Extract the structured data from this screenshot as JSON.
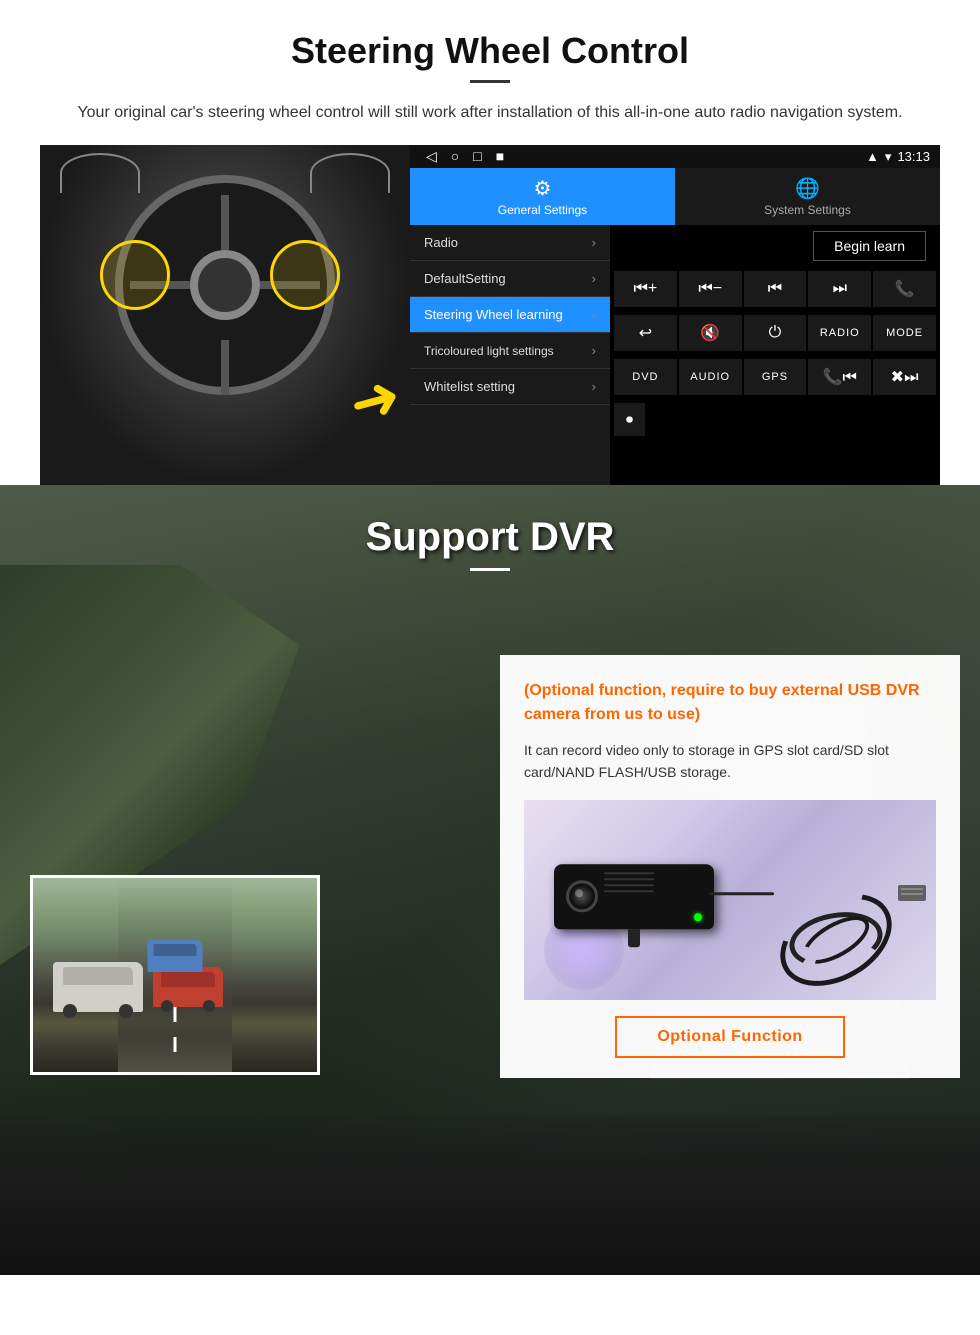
{
  "page": {
    "sections": {
      "steering": {
        "title": "Steering Wheel Control",
        "subtitle": "Your original car's steering wheel control will still work after installation of this all-in-one auto radio navigation system.",
        "statusbar": {
          "time": "13:13",
          "nav_items": [
            "◁",
            "○",
            "□",
            "■"
          ]
        },
        "tabs": {
          "general": {
            "label": "General Settings",
            "icon": "⚙"
          },
          "system": {
            "label": "System Settings",
            "icon": "🌐"
          }
        },
        "menu": {
          "items": [
            {
              "label": "Radio",
              "active": false
            },
            {
              "label": "DefaultSetting",
              "active": false
            },
            {
              "label": "Steering Wheel learning",
              "active": true
            },
            {
              "label": "Tricoloured light settings",
              "active": false
            },
            {
              "label": "Whitelist setting",
              "active": false
            }
          ]
        },
        "control_panel": {
          "begin_learn": "Begin learn",
          "row1": [
            "⏮+",
            "⏮−",
            "⏮",
            "⏭",
            "📞"
          ],
          "row2": [
            "↩",
            "🔇×",
            "⏻",
            "RADIO",
            "MODE"
          ],
          "row3": [
            "DVD",
            "AUDIO",
            "GPS",
            "📞⏮",
            "✖⏭"
          ],
          "row4": [
            "⏺"
          ]
        }
      },
      "dvr": {
        "title": "Support DVR",
        "optional_text": "(Optional function, require to buy external USB DVR camera from us to use)",
        "description": "It can record video only to storage in GPS slot card/SD slot card/NAND FLASH/USB storage.",
        "optional_button": "Optional Function"
      }
    }
  }
}
